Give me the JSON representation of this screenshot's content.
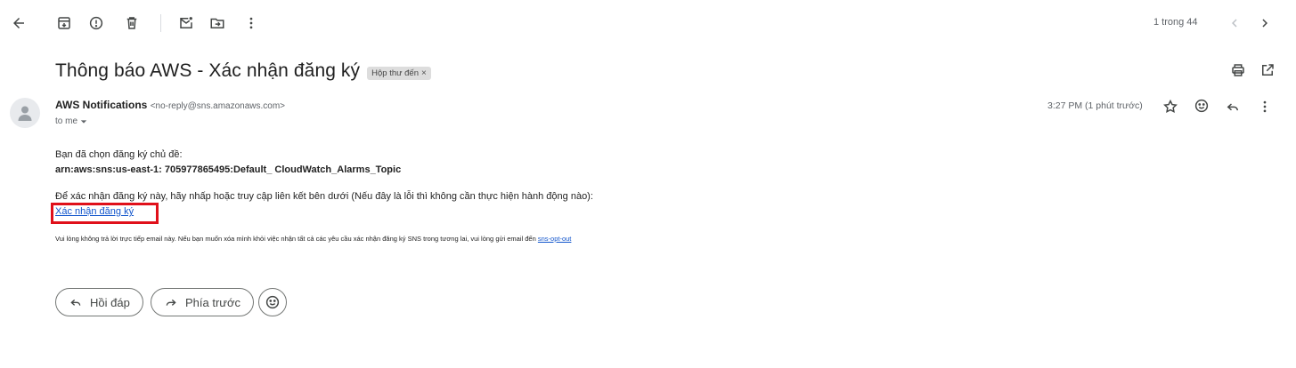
{
  "toolbar": {
    "icons": [
      "back-arrow-icon",
      "archive-icon",
      "report-spam-icon",
      "delete-icon",
      "mark-unread-icon",
      "move-to-icon",
      "more-vert-icon"
    ],
    "pager": "1 trong 44"
  },
  "email": {
    "subject": "Thông báo AWS - Xác nhận đăng ký",
    "label": "Hộp thư đến",
    "label_close": "×",
    "sender_name": "AWS Notifications",
    "sender_email": "<no-reply@sns.amazonaws.com>",
    "to": "to me",
    "time": "3:27 PM (1 phút trước)",
    "body": {
      "line1": "Bạn đã chọn đăng ký chủ đề:",
      "topic_arn": "arn:aws:sns:us-east-1: 705977865495:Default_ CloudWatch_Alarms_Topic",
      "line2": "Để xác nhận đăng ký này, hãy nhấp hoặc truy cập liên kết bên dưới (Nếu đây là lỗi thì không cần thực hiện hành động nào):",
      "confirm_link": "Xác nhận đăng ký",
      "footer": "Vui lòng không trả lời trực tiếp email này. Nếu bạn muốn xóa mình khỏi việc nhận tất cả các yêu cầu xác nhận đăng ký SNS trong tương lai, vui lòng gửi email đến",
      "opt_out_link": "sns-opt-out"
    }
  },
  "actions": {
    "reply": "Hồi đáp",
    "forward": "Phía trước"
  },
  "colors": {
    "link": "#1155cc",
    "highlight_border": "#e0101a",
    "icon": "#444746"
  }
}
